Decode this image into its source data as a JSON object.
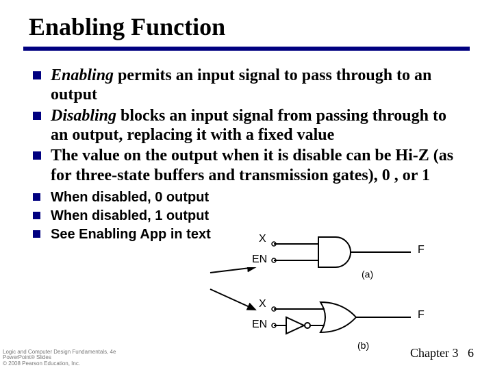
{
  "title": "Enabling Function",
  "bullets": {
    "b1_em": "Enabling",
    "b1_rest": " permits an input signal to pass through to an output",
    "b2_em": "Disabling",
    "b2_rest": " blocks an input signal from passing through to an output, replacing it with a fixed value",
    "b3": "The value on the output when it is disable can be Hi-Z (as for three-state buffers and transmission gates), 0 , or 1"
  },
  "sub": {
    "s1": "When disabled, 0 output",
    "s2": "When disabled, 1 output",
    "s3": "See Enabling App in text"
  },
  "diagram": {
    "x": "X",
    "en": "EN",
    "f": "F",
    "a": "(a)",
    "b": "(b)"
  },
  "footer": {
    "l1": "Logic and Computer Design Fundamentals, 4e",
    "l2": "PowerPoint® Slides",
    "l3": "© 2008 Pearson Education, Inc.",
    "chapter": "Chapter 3",
    "page": "6"
  }
}
